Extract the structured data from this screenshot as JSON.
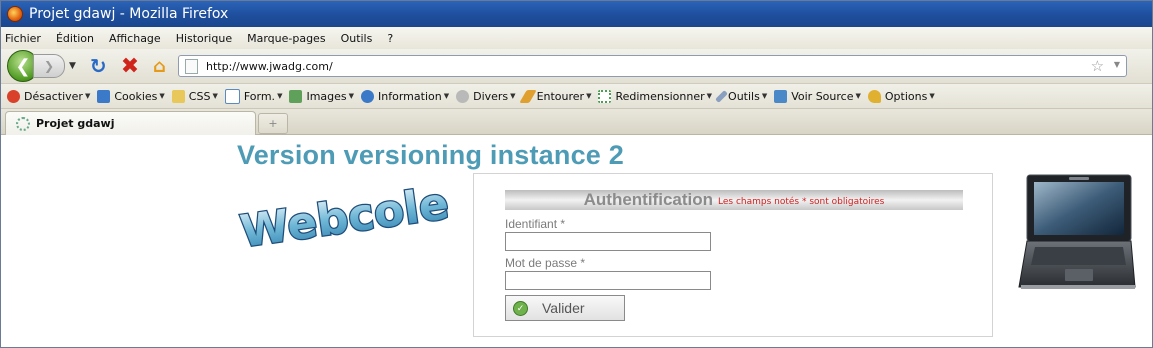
{
  "window": {
    "title": "Projet gdawj - Mozilla Firefox"
  },
  "menu": [
    "Fichier",
    "Édition",
    "Affichage",
    "Historique",
    "Marque-pages",
    "Outils",
    "?"
  ],
  "nav": {
    "url": "http://www.jwadg.com/"
  },
  "devbar": [
    {
      "label": "Désactiver",
      "icon": "disable-icon",
      "color": "#d9412b"
    },
    {
      "label": "Cookies",
      "icon": "cookie-icon",
      "color": "#3a7ac9"
    },
    {
      "label": "CSS",
      "icon": "css-icon",
      "color": "#e8c85a"
    },
    {
      "label": "Form.",
      "icon": "form-icon",
      "color": "#5a8ac0"
    },
    {
      "label": "Images",
      "icon": "image-icon",
      "color": "#5fa05a"
    },
    {
      "label": "Information",
      "icon": "info-icon",
      "color": "#3a78c8"
    },
    {
      "label": "Divers",
      "icon": "misc-icon",
      "color": "#b9b9b9"
    },
    {
      "label": "Entourer",
      "icon": "outline-icon",
      "color": "#e0a030"
    },
    {
      "label": "Redimensionner",
      "icon": "resize-icon",
      "color": "#4aa050"
    },
    {
      "label": "Outils",
      "icon": "tools-icon",
      "color": "#8aa0c0"
    },
    {
      "label": "Voir Source",
      "icon": "view-source-icon",
      "color": "#4a88c8"
    },
    {
      "label": "Options",
      "icon": "options-icon",
      "color": "#e0b030"
    }
  ],
  "tab": {
    "label": "Projet gdawj"
  },
  "page": {
    "heading": "Version versioning instance 2",
    "logo_text": "Webcole",
    "auth": {
      "title": "Authentification",
      "required_note": "Les champs notés * sont obligatoires",
      "login_label": "Identifiant *",
      "login_value": "",
      "password_label": "Mot de passe *",
      "password_value": "",
      "submit_label": "Valider"
    }
  }
}
